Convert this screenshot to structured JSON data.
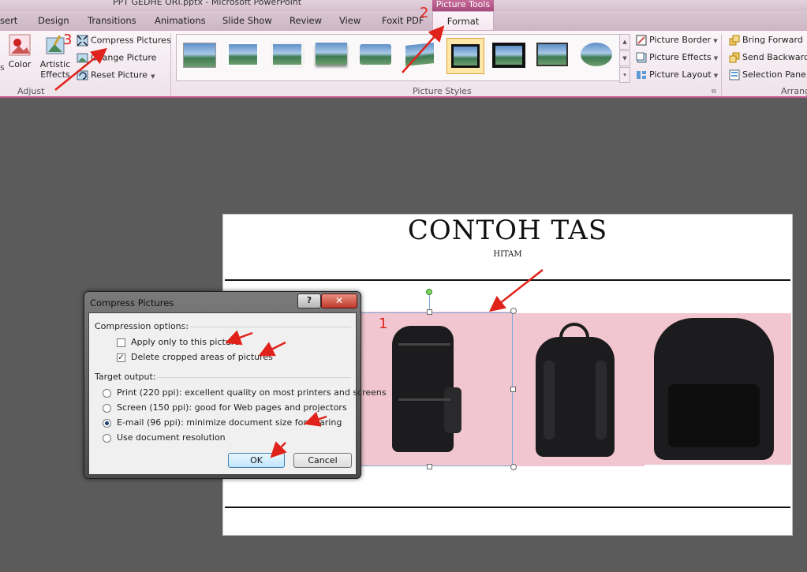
{
  "window": {
    "title": "PPT GEDHE ORI.pptx - Microsoft PowerPoint"
  },
  "contextual_tab": {
    "header": "Picture Tools",
    "tab": "Format"
  },
  "tabs": [
    "sert",
    "Design",
    "Transitions",
    "Animations",
    "Slide Show",
    "Review",
    "View",
    "Foxit PDF"
  ],
  "ribbon": {
    "adjust": {
      "color_label": "Color",
      "artistic_label": "Artistic",
      "effects_label": "Effects",
      "compress": "Compress Pictures",
      "change": "Change Picture",
      "reset": "Reset Picture",
      "group_label": "Adjust",
      "left_cut": "s"
    },
    "styles": {
      "group_label": "Picture Styles",
      "border": "Picture Border",
      "effects": "Picture Effects",
      "layout": "Picture Layout"
    },
    "arrange": {
      "group_label": "Arrang",
      "bring_forward": "Bring Forward",
      "send_backward": "Send Backward",
      "selection_pane": "Selection Pane"
    }
  },
  "slide": {
    "title": "CONTOH TAS",
    "subtitle": "HITAM"
  },
  "dialog": {
    "title": "Compress Pictures",
    "help": "?",
    "close": "✕",
    "compression_options": "Compression options:",
    "apply_only": "Apply only to this picture",
    "apply_only_checked": false,
    "delete_cropped": "Delete cropped areas of pictures",
    "delete_cropped_checked": true,
    "target_output": "Target output:",
    "options": [
      "Print (220 ppi): excellent quality on most printers and screens",
      "Screen (150 ppi): good for Web pages and projectors",
      "E-mail (96 ppi): minimize document size for sharing",
      "Use document resolution"
    ],
    "selected_option": 2,
    "ok": "OK",
    "cancel": "Cancel"
  },
  "annotations": {
    "step1": "1",
    "step2": "2",
    "step3": "3"
  },
  "colors": {
    "ribbon_accent": "#c55a90",
    "annotation_red": "#e0221a",
    "photo_bg": "#f1c6d0"
  }
}
